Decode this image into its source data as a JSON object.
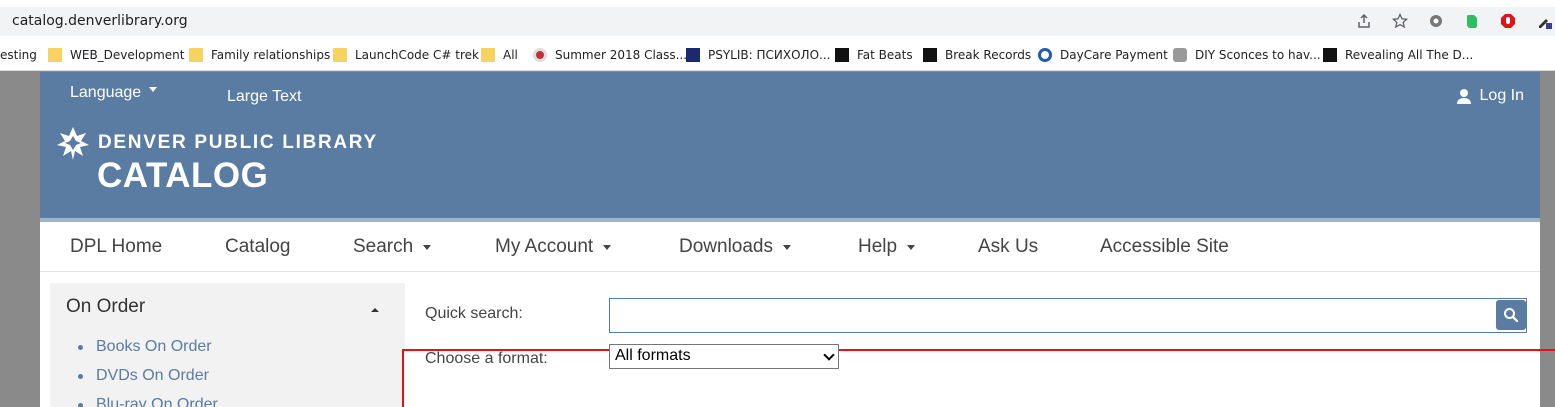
{
  "browser": {
    "url": "catalog.denverlibrary.org",
    "bookmarks": [
      {
        "label": "esting"
      },
      {
        "label": "WEB_Development"
      },
      {
        "label": "Family relationships"
      },
      {
        "label": "LaunchCode C# trek"
      },
      {
        "label": "All"
      },
      {
        "label": "Summer 2018 Class..."
      },
      {
        "label": "PSYLIB: ПСИХОЛО..."
      },
      {
        "label": "Fat Beats"
      },
      {
        "label": "Break Records"
      },
      {
        "label": "DayCare Payment"
      },
      {
        "label": "DIY Sconces to hav..."
      },
      {
        "label": "Revealing All The D..."
      }
    ]
  },
  "header": {
    "language": "Language",
    "large_text": "Large Text",
    "login": "Log In",
    "logo_top": "DENVER PUBLIC LIBRARY",
    "logo_big": "CATALOG"
  },
  "nav": {
    "items": [
      {
        "label": "DPL Home"
      },
      {
        "label": "Catalog"
      },
      {
        "label": "Search"
      },
      {
        "label": "My Account"
      },
      {
        "label": "Downloads"
      },
      {
        "label": "Help"
      },
      {
        "label": "Ask Us"
      },
      {
        "label": "Accessible Site"
      }
    ]
  },
  "sidebar": {
    "title": "On Order",
    "items": [
      {
        "label": "Books On Order"
      },
      {
        "label": "DVDs On Order"
      },
      {
        "label": "Blu-ray On Order"
      }
    ]
  },
  "search": {
    "quick_label": "Quick search:",
    "quick_value": "",
    "format_label": "Choose a format:",
    "format_value": "All formats"
  },
  "colors": {
    "header_bg": "#5a7ca3",
    "highlight": "#e0141b"
  }
}
